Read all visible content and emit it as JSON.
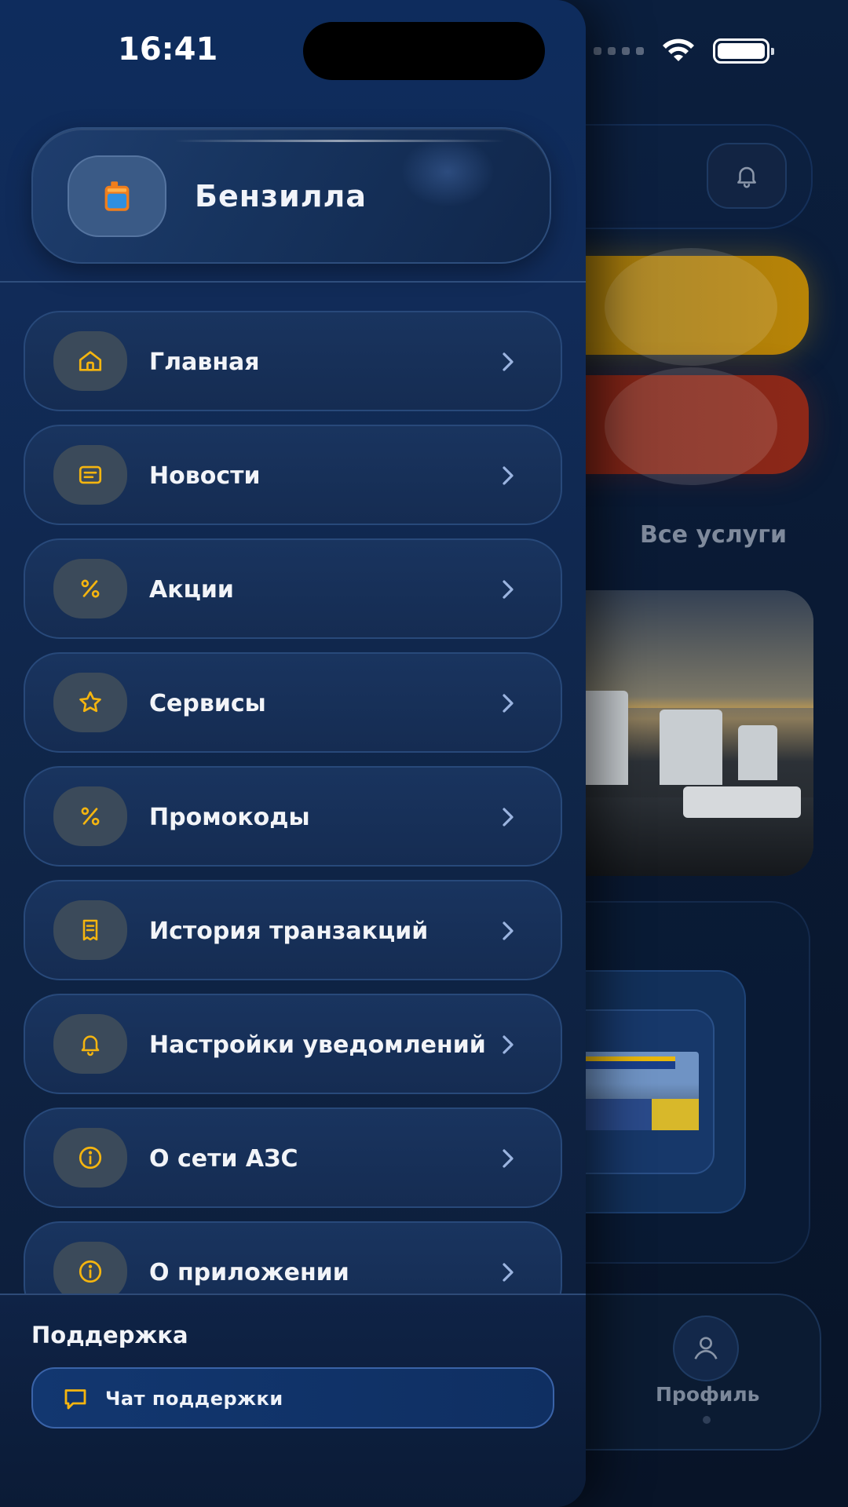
{
  "status_bar": {
    "time": "16:41"
  },
  "brand": {
    "name": "Бензилла",
    "logo_icon": "fuel-canister-icon"
  },
  "menu": {
    "items": [
      {
        "label": "Главная",
        "icon": "home-icon"
      },
      {
        "label": "Новости",
        "icon": "news-icon"
      },
      {
        "label": "Акции",
        "icon": "percent-icon"
      },
      {
        "label": "Сервисы",
        "icon": "star-icon"
      },
      {
        "label": "Промокоды",
        "icon": "percent-icon"
      },
      {
        "label": "История транзакций",
        "icon": "receipt-icon"
      },
      {
        "label": "Настройки уведомлений",
        "icon": "bell-icon"
      },
      {
        "label": "О сети АЗС",
        "icon": "info-icon"
      },
      {
        "label": "О приложении",
        "icon": "info-icon"
      }
    ]
  },
  "support": {
    "title": "Поддержка",
    "chat_label": "Чат поддержки"
  },
  "background_app": {
    "all_services": "Все услуги",
    "profile_tab": "Профиль"
  },
  "colors": {
    "accent_yellow": "#f5b50f",
    "drawer_bg": "#112b58",
    "chevron": "#9bb4e0"
  }
}
